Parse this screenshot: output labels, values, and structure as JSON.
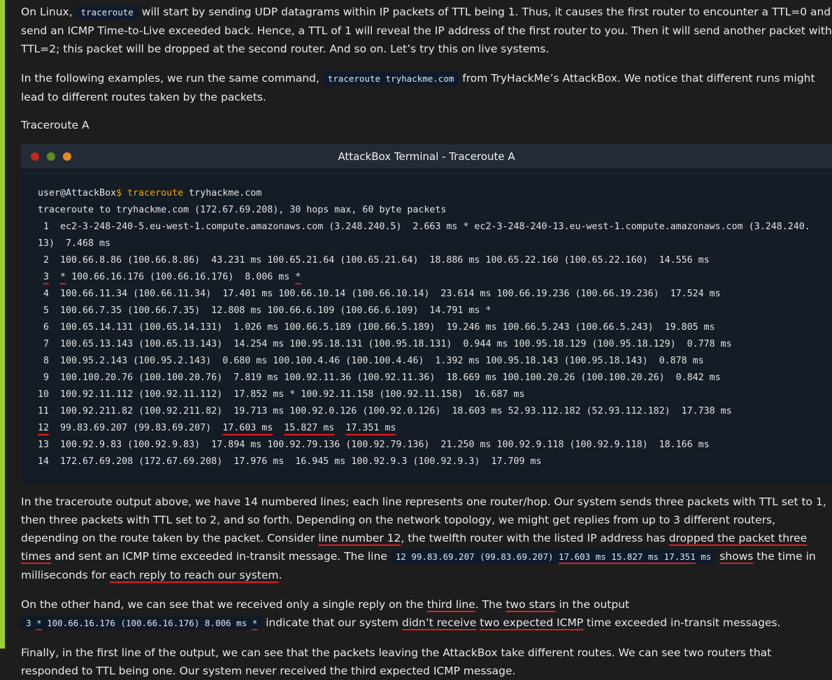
{
  "para1": {
    "before": "On Linux, ",
    "code": "traceroute",
    "after": " will start by sending UDP datagrams within IP packets of TTL being 1. Thus, it causes the first router to encounter a TTL=0 and send an ICMP Time-to-Live exceeded back. Hence, a TTL of 1 will reveal the IP address of the first router to you. Then it will send another packet with TTL=2; this packet will be dropped at the second router. And so on. Let’s try this on live systems."
  },
  "para2": {
    "before": "In the following examples, we run the same command, ",
    "code": "traceroute tryhackme.com",
    "after": " from TryHackMe’s AttackBox. We notice that different runs might lead to different routes taken by the packets."
  },
  "heading_a": "Traceroute A",
  "terminal": {
    "title": "AttackBox Terminal - Traceroute A",
    "prompt_user": "user@AttackBox",
    "prompt_symbol": "$",
    "command": "traceroute",
    "argument": " tryhackme.com",
    "header_line": "traceroute to tryhackme.com (172.67.69.208), 30 hops max, 60 byte packets",
    "line1": " 1  ec2-3-248-240-5.eu-west-1.compute.amazonaws.com (3.248.240.5)  2.663 ms * ec2-3-248-240-13.eu-west-1.compute.amazonaws.com (3.248.240.13)  7.468 ms",
    "line2": " 2  100.66.8.86 (100.66.8.86)  43.231 ms 100.65.21.64 (100.65.21.64)  18.886 ms 100.65.22.160 (100.65.22.160)  14.556 ms",
    "line3": {
      "hop": "3",
      "star1": "*",
      "mid": " 100.66.16.176 (100.66.16.176)  8.006 ms ",
      "star2": "*"
    },
    "line4": " 4  100.66.11.34 (100.66.11.34)  17.401 ms 100.66.10.14 (100.66.10.14)  23.614 ms 100.66.19.236 (100.66.19.236)  17.524 ms",
    "line5": " 5  100.66.7.35 (100.66.7.35)  12.808 ms 100.66.6.109 (100.66.6.109)  14.791 ms *",
    "line6": " 6  100.65.14.131 (100.65.14.131)  1.026 ms 100.66.5.189 (100.66.5.189)  19.246 ms 100.66.5.243 (100.66.5.243)  19.805 ms",
    "line7": " 7  100.65.13.143 (100.65.13.143)  14.254 ms 100.95.18.131 (100.95.18.131)  0.944 ms 100.95.18.129 (100.95.18.129)  0.778 ms",
    "line8": " 8  100.95.2.143 (100.95.2.143)  0.680 ms 100.100.4.46 (100.100.4.46)  1.392 ms 100.95.18.143 (100.95.18.143)  0.878 ms",
    "line9": " 9  100.100.20.76 (100.100.20.76)  7.819 ms 100.92.11.36 (100.92.11.36)  18.669 ms 100.100.20.26 (100.100.20.26)  0.842 ms",
    "line10": "10  100.92.11.112 (100.92.11.112)  17.852 ms * 100.92.11.158 (100.92.11.158)  16.687 ms",
    "line11": "11  100.92.211.82 (100.92.211.82)  19.713 ms 100.92.0.126 (100.92.0.126)  18.603 ms 52.93.112.182 (52.93.112.182)  17.738 ms",
    "line12": {
      "hop": "12",
      "ip": "  99.83.69.207 (99.83.69.207)  ",
      "t1": "17.603 ms",
      "t2": "15.827 ms",
      "t3": "17.351 ms"
    },
    "line13": "13  100.92.9.83 (100.92.9.83)  17.894 ms 100.92.79.136 (100.92.79.136)  21.250 ms 100.92.9.118 (100.92.9.118)  18.166 ms",
    "line14": "14  172.67.69.208 (172.67.69.208)  17.976 ms  16.945 ms 100.92.9.3 (100.92.9.3)  17.709 ms"
  },
  "para3": {
    "p1": "In the traceroute output above, we have 14 numbered lines; each line represents one router/hop. Our system sends three packets with TTL set to 1, then three packets with TTL set to 2, and so forth. Depending on the network topology, we might get replies from up to 3 different routers, depending on the route taken by the packet. Consider ",
    "u1": "line number 12",
    "p2": ", the twelfth router with the listed IP address has ",
    "u2": "dropped the packet three times",
    "p3": " and sent an ICMP time exceeded in-transit message. The line ",
    "code_a": "12 99.83.69.207 (99.83.69.207) ",
    "code_u": "17.603 ms 15.827 ms 17.351",
    "code_b": " ms",
    "p4": " ",
    "u3": "shows",
    "p5": " the time in milliseconds for ",
    "u4": "each reply to reach our system",
    "p6": "."
  },
  "para4": {
    "p1": "On the other hand, we can see that we received only a single reply on the ",
    "u1": "third line",
    "p2": ". The ",
    "u2": "two stars",
    "p3": " in the output",
    "code_a": "3 ",
    "code_star1": "*",
    "code_mid": " 100.66.16.176 (100.66.16.176) 8.006 ms ",
    "code_star2": "*",
    "p4": " indicate that our system ",
    "u3": "didn’t receive",
    "p5": " ",
    "u4": "two expected ICMP",
    "p6": " time exceeded in-transit messages."
  },
  "para5": "Finally, in the first line of the output, we can see that the packets leaving the AttackBox take different routes. We can see two routers that responded to TTL being one. Our system never received the third expected ICMP message."
}
